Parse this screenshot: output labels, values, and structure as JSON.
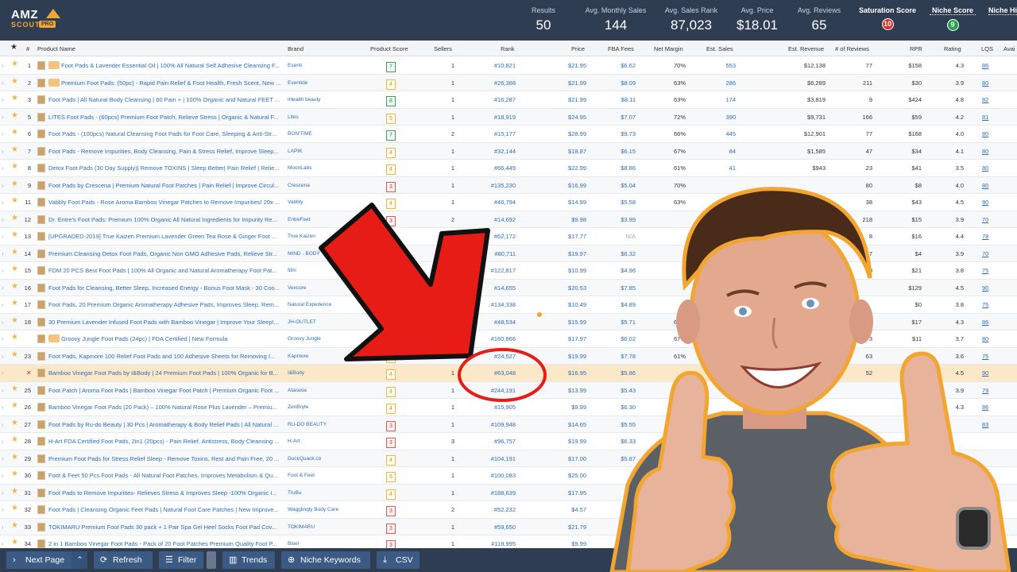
{
  "logo": {
    "amz": "AMZ",
    "scout": "SCOUT",
    "pro": "PRO"
  },
  "stats": [
    {
      "label": "Results",
      "value": "50"
    },
    {
      "label": "Avg. Monthly Sales",
      "value": "144"
    },
    {
      "label": "Avg. Sales Rank",
      "value": "87,023"
    },
    {
      "label": "Avg. Price",
      "value": "$18.01"
    },
    {
      "label": "Avg. Reviews",
      "value": "65"
    }
  ],
  "scores": [
    {
      "label": "Saturation Score",
      "value": "10",
      "color": "#d9302d"
    },
    {
      "label": "Niche Score",
      "value": "9",
      "color": "#2aa152"
    },
    {
      "label": "Niche Hi",
      "value": ""
    }
  ],
  "columns": {
    "hash": "#",
    "product_name": "Product Name",
    "brand": "Brand",
    "product_score": "Product Score",
    "sellers": "Sellers",
    "rank": "Rank",
    "price": "Price",
    "fba_fees": "FBA Fees",
    "net_margin": "Net Margin",
    "est_sales": "Est. Sales",
    "est_revenue": "Est. Revenue",
    "reviews": "# of Reviews",
    "rpr": "RPR",
    "rating": "Rating",
    "lqs": "LQS",
    "avail": "Avai"
  },
  "rows": [
    {
      "n": "1",
      "name": "Foot Pads & Lavender Essential Oil | 100% All Natural Self Adhesive Cleansing F...",
      "brand": "Esenti",
      "score": "7",
      "sc": "g",
      "sellers": "1",
      "rank": "#10,821",
      "price": "$21.95",
      "fba": "$6.62",
      "margin": "70%",
      "sales": "553",
      "rev": "$12,138",
      "reviews": "77",
      "rpr": "$158",
      "rating": "4.3",
      "lqs": "86",
      "img": true
    },
    {
      "n": "2",
      "name": "Premium Foot Pads: (50pc) - Rapid Pain Relief & Foot Health, Fresh Scent, New ...",
      "brand": "Eventide",
      "score": "4",
      "sc": "y",
      "sellers": "1",
      "rank": "#26,388",
      "price": "$21.99",
      "fba": "$8.09",
      "margin": "63%",
      "sales": "286",
      "rev": "$6,289",
      "reviews": "211",
      "rpr": "$30",
      "rating": "3.9",
      "lqs": "80",
      "img": true
    },
    {
      "n": "3",
      "name": "Foot Pads | All Natural Body Cleansing | 60 Pain + | 100% Organic and Natural FEET ...",
      "brand": "iHealth beauty",
      "score": "8",
      "sc": "g",
      "sellers": "1",
      "rank": "#16,287",
      "price": "$21.99",
      "fba": "$8.11",
      "margin": "63%",
      "sales": "174",
      "rev": "$3,819",
      "reviews": "9",
      "rpr": "$424",
      "rating": "4.8",
      "lqs": "82"
    },
    {
      "n": "5",
      "name": "LITES Foot Pads - (60pcs) Premium Foot Patch, Relieve Stress | Organic & Natural F...",
      "brand": "Lites",
      "score": "5",
      "sc": "y",
      "sellers": "1",
      "rank": "#18,919",
      "price": "$24.95",
      "fba": "$7.07",
      "margin": "72%",
      "sales": "390",
      "rev": "$9,731",
      "reviews": "166",
      "rpr": "$59",
      "rating": "4.2",
      "lqs": "81"
    },
    {
      "n": "6",
      "name": "Foot Pads - (100pcs) Natural Cleansing Foot Pads for Foot Care, Sleeping & Anti-Str...",
      "brand": "BON'TIME",
      "score": "7",
      "sc": "g",
      "sellers": "2",
      "rank": "#15,177",
      "price": "$28.99",
      "fba": "$9.73",
      "margin": "66%",
      "sales": "445",
      "rev": "$12,901",
      "reviews": "77",
      "rpr": "$168",
      "rating": "4.0",
      "lqs": "80"
    },
    {
      "n": "7",
      "name": "Foot Pads - Remove Impurities, Body Cleansing, Pain & Stress Relief, Improve Sleep...",
      "brand": "LAPIK",
      "score": "4",
      "sc": "y",
      "sellers": "1",
      "rank": "#32,144",
      "price": "$18.87",
      "fba": "$6.15",
      "margin": "67%",
      "sales": "84",
      "rev": "$1,585",
      "reviews": "47",
      "rpr": "$34",
      "rating": "4.1",
      "lqs": "80"
    },
    {
      "n": "8",
      "name": "Detox Foot Pads (30 Day Supply)| Remove TOXINS | Sleep Better| Pain Relief | Relie...",
      "brand": "MoonLabs",
      "score": "4",
      "sc": "y",
      "sellers": "1",
      "rank": "#66,449",
      "price": "$22.99",
      "fba": "$8.86",
      "margin": "61%",
      "sales": "41",
      "rev": "$943",
      "reviews": "23",
      "rpr": "$41",
      "rating": "3.5",
      "lqs": "80"
    },
    {
      "n": "9",
      "name": "Foot Pads by Crescena | Premium Natural Foot Patches | Pain Relief | Improve Circul...",
      "brand": "Crescena",
      "score": "3",
      "sc": "r",
      "sellers": "1",
      "rank": "#135,230",
      "price": "$16.99",
      "fba": "$5.04",
      "margin": "70%",
      "sales": "",
      "rev": "",
      "reviews": "80",
      "rpr": "$8",
      "rating": "4.0",
      "lqs": "80"
    },
    {
      "n": "11",
      "name": "Vabbly Foot Pads - Rose Aroma Bamboo Vinegar Patches to Remove Impurities! 20x ...",
      "brand": "Vabbly",
      "score": "4",
      "sc": "y",
      "sellers": "1",
      "rank": "#46,794",
      "price": "$14.99",
      "fba": "$5.58",
      "margin": "63%",
      "sales": "",
      "rev": "",
      "reviews": "38",
      "rpr": "$43",
      "rating": "4.5",
      "lqs": "90"
    },
    {
      "n": "12",
      "name": "Dr. Entre's Foot Pads: Premium 100% Organic All Natural Ingredients for Impurity Re...",
      "brand": "EntreFeet",
      "score": "3",
      "sc": "r",
      "sellers": "2",
      "rank": "#14,692",
      "price": "$9.98",
      "fba": "$3.99",
      "margin": "",
      "sales": "",
      "rev": "",
      "reviews": "218",
      "rpr": "$15",
      "rating": "3.9",
      "lqs": "70"
    },
    {
      "n": "13",
      "name": "[UPGRADED-2019] True Kaizen Premium Lavender Green Tea Rose & Ginger Foot ...",
      "brand": "True Kaizen",
      "score": "4",
      "sc": "y",
      "sellers": "1",
      "rank": "#62,172",
      "price": "$17.77",
      "fba": "N/A",
      "margin": "",
      "sales": "",
      "rev": "",
      "reviews": "8",
      "rpr": "$16",
      "rating": "4.4",
      "lqs": "78"
    },
    {
      "n": "14",
      "name": "Premium Cleansing Detox Foot Pads, Organic Non GMO Adhesive Pads, Relieve Str...",
      "brand": "MIND · BODY",
      "score": "4",
      "sc": "y",
      "sellers": "2",
      "rank": "#80,711",
      "price": "$19.97",
      "fba": "$6.32",
      "margin": "",
      "sales": "",
      "rev": "",
      "reviews": "7",
      "rpr": "$4",
      "rating": "3.9",
      "lqs": "70"
    },
    {
      "n": "15",
      "name": "FDM 20 PCS Best Foot Pads | 100% All Organic and Natural Aromatherapy Foot Pat...",
      "brand": "fdm",
      "score": "4",
      "sc": "y",
      "sellers": "1",
      "rank": "#122,817",
      "price": "$10.99",
      "fba": "$4.96",
      "margin": "",
      "sales": "",
      "rev": "",
      "reviews": "0",
      "rpr": "$21",
      "rating": "3.8",
      "lqs": "75"
    },
    {
      "n": "16",
      "name": "Foot Pads for Cleansing, Better Sleep, Increased Energy - Bonus Foot Mask - 30 Coo...",
      "brand": "Vexcore",
      "score": "4",
      "sc": "y",
      "sellers": "1",
      "rank": "#14,655",
      "price": "$20.53",
      "fba": "$7.85",
      "margin": "",
      "sales": "",
      "rev": "",
      "reviews": "",
      "rpr": "$129",
      "rating": "4.5",
      "lqs": "90"
    },
    {
      "n": "17",
      "name": "Foot Pads, 20 Premium Organic Aromatherapy Adhesive Pads, Improves Sleep, Rem...",
      "brand": "Natural Experience",
      "score": "4",
      "sc": "y",
      "sellers": "1",
      "rank": "#134,338",
      "price": "$10.49",
      "fba": "$4.89",
      "margin": "",
      "sales": "",
      "rev": "",
      "reviews": "",
      "rpr": "$0",
      "rating": "3.8",
      "lqs": "75"
    },
    {
      "n": "18",
      "name": "30 Premium Lavender Infused Foot Pads with Bamboo Vinegar | Improve Your Sleep!...",
      "brand": "JH-OUTLET",
      "score": "4",
      "sc": "y",
      "sellers": "1",
      "rank": "#48,534",
      "price": "$15.99",
      "fba": "$5.71",
      "margin": "64%",
      "sales": "",
      "rev": "",
      "reviews": "",
      "rpr": "$17",
      "rating": "4.3",
      "lqs": "86"
    },
    {
      "n": "",
      "name": "Groovy Jungle Foot Pads (24pc) | FDA Certified | New Formula",
      "brand": "Groovy Jungle",
      "score": "4",
      "sc": "y",
      "sellers": "",
      "rank": "#160,866",
      "price": "$17.97",
      "fba": "$6.02",
      "margin": "67%",
      "sales": "",
      "rev": "",
      "reviews": "3",
      "rpr": "$11",
      "rating": "3.7",
      "lqs": "80",
      "img": true
    },
    {
      "n": "23",
      "name": "Foot Pads, Kapmore 100 Relief Foot Pads and 100 Adhesive Sheets for Removing I...",
      "brand": "Kapmore",
      "score": "4",
      "sc": "y",
      "sellers": "3",
      "rank": "#24,527",
      "price": "$19.99",
      "fba": "$7.78",
      "margin": "61%",
      "sales": "",
      "rev": "",
      "reviews": "63",
      "rpr": "",
      "rating": "3.6",
      "lqs": "75"
    },
    {
      "n": "",
      "name": "Bamboo Vinegar Foot Pads by I&Body | 24 Premium Foot Pads | 100% Organic for B...",
      "brand": "I&Body",
      "score": "4",
      "sc": "y",
      "sellers": "1",
      "rank": "#63,048",
      "price": "$16.95",
      "fba": "$5.86",
      "margin": "",
      "sales": "",
      "rev": "",
      "reviews": "52",
      "rpr": "",
      "rating": "4.5",
      "lqs": "90",
      "hl": true
    },
    {
      "n": "25",
      "name": "Foot Patch | Aroma Foot Pads | Bamboo Vinegar Foot Patch | Premium Organic Foot ...",
      "brand": "Ataraxia",
      "score": "4",
      "sc": "y",
      "sellers": "1",
      "rank": "#244,191",
      "price": "$13.99",
      "fba": "$5.43",
      "margin": "",
      "sales": "",
      "rev": "",
      "reviews": "",
      "rpr": "",
      "rating": "3.9",
      "lqs": "79"
    },
    {
      "n": "26",
      "name": "Bamboo Vinegar Foot Pads (20 Pack) – 100% Natural Rose Plus Lavender – Premiu...",
      "brand": "ZenBryte",
      "score": "4",
      "sc": "y",
      "sellers": "1",
      "rank": "#15,905",
      "price": "$9.99",
      "fba": "$6.30",
      "margin": "",
      "sales": "",
      "rev": "",
      "reviews": "",
      "rpr": "",
      "rating": "4.3",
      "lqs": "86"
    },
    {
      "n": "27",
      "name": "Foot Pads by Ru-do Beauty | 30 Pcs | Aromatherapy & Body Relief Pads | All Natural ...",
      "brand": "RU-DO BEAUTY",
      "score": "3",
      "sc": "r",
      "sellers": "1",
      "rank": "#109,948",
      "price": "$14.65",
      "fba": "$5.55",
      "margin": "",
      "sales": "",
      "rev": "",
      "reviews": "",
      "rpr": "",
      "rating": "",
      "lqs": "83"
    },
    {
      "n": "28",
      "name": "H-Art FDA Certified Foot Pads, 2in1 (20pcs) - Pain Relief, Antistress, Body Cleansing ...",
      "brand": "H-Art",
      "score": "3",
      "sc": "r",
      "sellers": "3",
      "rank": "#96,757",
      "price": "$19.99",
      "fba": "$6.33",
      "margin": "",
      "sales": "",
      "rev": "",
      "reviews": "",
      "rpr": "",
      "rating": "",
      "lqs": ""
    },
    {
      "n": "29",
      "name": "Premium Foot Pads for Stress Relief Sleep - Remove Toxins, Rest and Pain Free, 20 ...",
      "brand": "DuckQuack.co",
      "score": "4",
      "sc": "y",
      "sellers": "1",
      "rank": "#104,191",
      "price": "$17.00",
      "fba": "$5.87",
      "margin": "",
      "sales": "",
      "rev": "",
      "reviews": "",
      "rpr": "",
      "rating": "",
      "lqs": ""
    },
    {
      "n": "30",
      "name": "Foot & Feet 50 Pcs Foot Pads - All Natural Foot Patches, Improves Metabolism & Qu...",
      "brand": "Foot & Feet",
      "score": "5",
      "sc": "y",
      "sellers": "1",
      "rank": "#100,083",
      "price": "$25.00",
      "fba": "",
      "margin": "",
      "sales": "",
      "rev": "",
      "reviews": "",
      "rpr": "",
      "rating": "",
      "lqs": ""
    },
    {
      "n": "31",
      "name": "Foot Pads to Remove Impurities- Relieves Stress & Improves Sleep -100% Organic I...",
      "brand": "TruBu",
      "score": "4",
      "sc": "y",
      "sellers": "1",
      "rank": "#188,639",
      "price": "$17.95",
      "fba": "",
      "margin": "",
      "sales": "",
      "rev": "",
      "reviews": "",
      "rpr": "",
      "rating": "",
      "lqs": ""
    },
    {
      "n": "32",
      "name": "Foot Pads | Cleansing Organic Feet Pads | Natural Foot Care Patches | New Improve...",
      "brand": "Wagglingly Body Care",
      "score": "3",
      "sc": "r",
      "sellers": "2",
      "rank": "#52,232",
      "price": "$4.57",
      "fba": "",
      "margin": "",
      "sales": "",
      "rev": "",
      "reviews": "",
      "rpr": "",
      "rating": "",
      "lqs": ""
    },
    {
      "n": "33",
      "name": "TOKIMARU Premium Foot Pads 30 pack + 1 Pair Spa Gel Heel Socks Foot Pad Cov...",
      "brand": "TOKIMARU",
      "score": "3",
      "sc": "r",
      "sellers": "1",
      "rank": "#59,650",
      "price": "$21.79",
      "fba": "",
      "margin": "",
      "sales": "",
      "rev": "",
      "reviews": "",
      "rpr": "",
      "rating": "",
      "lqs": ""
    },
    {
      "n": "34",
      "name": "2 in 1 Bamboo Vinegar Foot Pads - Pack of 20 Foot Patches Premium Quality Foot P...",
      "brand": "Bisel",
      "score": "3",
      "sc": "r",
      "sellers": "1",
      "rank": "#118,995",
      "price": "$9.99",
      "fba": "",
      "margin": "",
      "sales": "",
      "rev": "",
      "reviews": "",
      "rpr": "",
      "rating": "",
      "lqs": ""
    }
  ],
  "toolbar": {
    "next_page": "Next Page",
    "refresh": "Refresh",
    "filter": "Filter",
    "trends": "Trends",
    "niche_keywords": "Niche Keywords",
    "csv": "CSV"
  },
  "colors": {
    "header": "#2f3d52",
    "button": "#3b5b84",
    "link": "#2c6db8",
    "highlight_row": "#fbe8c9",
    "arrow": "#e81c16",
    "circle": "#e81c16"
  }
}
